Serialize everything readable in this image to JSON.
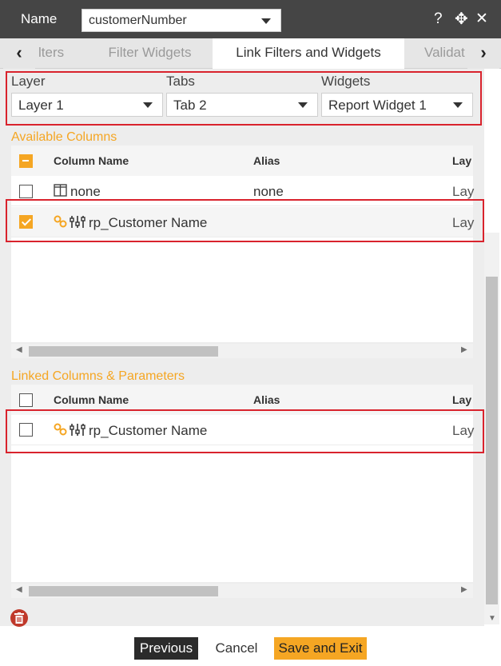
{
  "header": {
    "name_label": "Name",
    "name_value": "customerNumber",
    "help_icon": "?",
    "move_icon": "✥",
    "close_icon": "✕"
  },
  "tabs": {
    "prev_arrow": "‹",
    "next_arrow": "›",
    "items": [
      {
        "label": "lters"
      },
      {
        "label": "Filter Widgets"
      },
      {
        "label": "Link Filters and Widgets"
      },
      {
        "label": "Validat"
      }
    ],
    "active_index": 2
  },
  "selectors": {
    "layer": {
      "label": "Layer",
      "value": "Layer 1"
    },
    "tabs": {
      "label": "Tabs",
      "value": "Tab 2"
    },
    "widgets": {
      "label": "Widgets",
      "value": "Report Widget 1"
    }
  },
  "available": {
    "title": "Available Columns",
    "headers": [
      "Column Name",
      "Alias",
      "Lay"
    ],
    "rows": [
      {
        "name": "none",
        "alias": "none",
        "layer": "Lay",
        "checked": false,
        "icon": "columns-icon"
      },
      {
        "name": "rp_Customer Name",
        "alias": "",
        "layer": "Lay",
        "checked": true,
        "icon": "link-parameter-icon"
      }
    ]
  },
  "linked": {
    "title": "Linked Columns & Parameters",
    "headers": [
      "Column Name",
      "Alias",
      "Lay"
    ],
    "rows": [
      {
        "name": "rp_Customer Name",
        "alias": "",
        "layer": "Lay",
        "checked": false,
        "icon": "link-parameter-icon"
      }
    ]
  },
  "footer": {
    "previous": "Previous",
    "cancel": "Cancel",
    "save_exit": "Save and Exit"
  },
  "colors": {
    "accent": "#f5a623",
    "header_bg": "#454545",
    "highlight": "#d9232d",
    "delete": "#c0392b"
  }
}
